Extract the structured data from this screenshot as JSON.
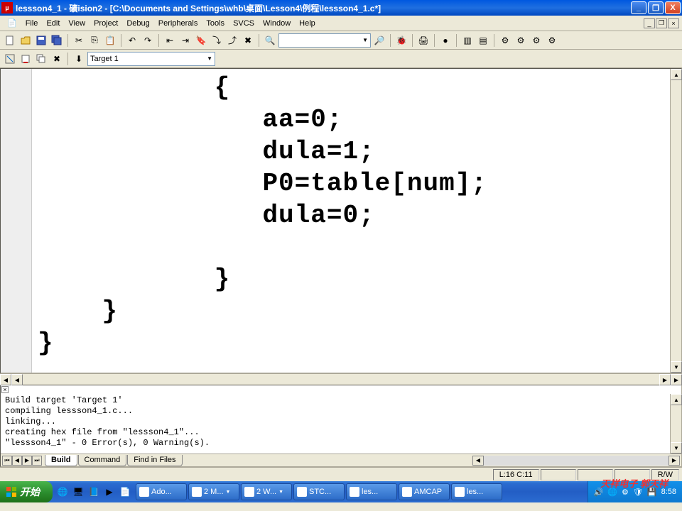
{
  "titlebar": {
    "text": "lessson4_1 - 礦ision2 - [C:\\Documents and Settings\\whb\\桌面\\Lesson4\\例程\\lessson4_1.c*]"
  },
  "menu": {
    "file": "File",
    "edit": "Edit",
    "view": "View",
    "project": "Project",
    "debug": "Debug",
    "peripherals": "Peripherals",
    "tools": "Tools",
    "svcs": "SVCS",
    "window": "Window",
    "help": "Help"
  },
  "toolbar": {
    "target_label": "Target 1",
    "find_combo": ""
  },
  "editor": {
    "code": "           {\n              aa=0;\n              dula=1;\n              P0=table[num];\n              dula=0;\n\n           }\n    }\n}"
  },
  "output": {
    "lines": "Build target 'Target 1'\ncompiling lessson4_1.c...\nlinking...\ncreating hex file from \"lessson4_1\"...\n\"lessson4_1\" - 0 Error(s), 0 Warning(s).",
    "tabs": {
      "build": "Build",
      "command": "Command",
      "find": "Find in Files"
    }
  },
  "status": {
    "pos": "L:16 C:11",
    "rw": "R/W"
  },
  "watermark": "天祥电子  郭天祥",
  "taskbar": {
    "start": "开始",
    "items": [
      "Ado...",
      "2 M...",
      "2 W...",
      "STC...",
      "les...",
      "AMCAP",
      "les..."
    ],
    "clock": "8:58"
  }
}
